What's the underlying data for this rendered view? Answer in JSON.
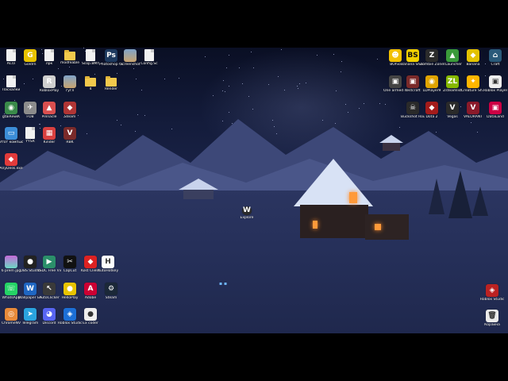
{
  "desktop": {
    "left_icons": [
      {
        "label": "AC\\n",
        "glyph": "file"
      },
      {
        "label": "Goldrn",
        "glyph": "G",
        "color": "#e7c200"
      },
      {
        "label": "лрк",
        "glyph": "file"
      },
      {
        "label": "modfeable",
        "glyph": "folder"
      },
      {
        "label": "Scop.BMY",
        "glyph": "file"
      },
      {
        "label": "Photoshop CC",
        "glyph": "Ps",
        "color": "#1e3a5f"
      },
      {
        "label": "Screenshot",
        "glyph": "img"
      },
      {
        "label": "Config.Sc",
        "glyph": "file"
      },
      {
        "label": "Пасхалки",
        "glyph": "file"
      },
      {
        "label": "RobloxPlay",
        "glyph": "R",
        "color": "#cfcfcf"
      },
      {
        "label": "гугл",
        "glyph": "img"
      },
      {
        "label": "4",
        "glyph": "folder"
      },
      {
        "label": "Render",
        "glyph": "folder"
      },
      {
        "label": "gtaiRewiK",
        "glyph": "◉",
        "color": "#3a8a4a"
      },
      {
        "label": "FOB",
        "glyph": "✈",
        "color": "#8c8c8c"
      },
      {
        "label": "Pinnacle",
        "glyph": "▲",
        "color": "#d94f4f"
      },
      {
        "label": "Steam",
        "glyph": "◆",
        "color": "#b03535"
      },
      {
        "label": "Этот компьютер",
        "glyph": "▭",
        "color": "#3c8dd8"
      },
      {
        "label": "YYSR",
        "glyph": "file"
      },
      {
        "label": "Kinder",
        "glyph": "▦",
        "color": "#d94040"
      },
      {
        "label": "RBK",
        "glyph": "V",
        "color": "#7a2a2a"
      },
      {
        "label": "AnyDesk.exe",
        "glyph": "◆",
        "color": "#e23b3b"
      },
      {
        "label": "6 prem jpg",
        "glyph": "img2"
      },
      {
        "label": "OBS Studio",
        "glyph": "●",
        "color": "#222"
      },
      {
        "label": "YSDC Free Video Editor",
        "glyph": "▶",
        "color": "#2b8f6a"
      },
      {
        "label": "CapCut",
        "glyph": "✂",
        "color": "#111"
      },
      {
        "label": "Kost Client",
        "glyph": "◆",
        "color": "#d22"
      },
      {
        "label": "AutoHotkey",
        "glyph": "H",
        "color": "#fff",
        "text": "#333"
      },
      {
        "label": "WhatsApp",
        "glyph": "☏",
        "color": "#25d366"
      },
      {
        "label": "Wallpaper Engine",
        "glyph": "W",
        "color": "#1f66c2"
      },
      {
        "label": "AutoClicker",
        "glyph": "↖",
        "color": "#3a3a3a"
      },
      {
        "label": "HelloPlay",
        "glyph": "●",
        "color": "#e8c400"
      },
      {
        "label": "Adobe",
        "glyph": "A",
        "color": "#c03"
      },
      {
        "label": "Steam",
        "glyph": "⚙",
        "color": "#1b2838"
      },
      {
        "label": "ChromeNV",
        "glyph": "◎",
        "color": "#e88a3a"
      },
      {
        "label": "Telegram",
        "glyph": "➤",
        "color": "#2aa3df"
      },
      {
        "label": "Discord",
        "glyph": "◕",
        "color": "#5865f2"
      },
      {
        "label": "Roblox Studio",
        "glyph": "◈",
        "color": "#1c6fd6"
      },
      {
        "label": "Ex coder",
        "glyph": "●",
        "color": "#eee",
        "text": "#333"
      }
    ],
    "right_icons": [
      {
        "label": "BOhio",
        "glyph": "☻",
        "color": "#f2c100"
      },
      {
        "label": "Banana Shooter",
        "glyph": "BS",
        "color": "#f0d000",
        "text": "#111"
      },
      {
        "label": "Zombie Zone Zero",
        "glyph": "Z",
        "color": "#2b2b2b"
      },
      {
        "label": "TLauncher",
        "glyph": "▲",
        "color": "#3a9a3a"
      },
      {
        "label": "Banana",
        "glyph": "◆",
        "color": "#e3c200"
      },
      {
        "label": "Craft",
        "glyph": "⌂",
        "color": "#2a5a7a"
      },
      {
        "label": "One armed robber",
        "glyph": "▣",
        "color": "#444"
      },
      {
        "label": "Testcraft",
        "glyph": "▣",
        "color": "#7a2a2a"
      },
      {
        "label": "LDPlayer9",
        "glyph": "◉",
        "color": "#e0a400"
      },
      {
        "label": "Zsteamlist",
        "glyph": "ZL",
        "color": "#86b800"
      },
      {
        "label": "Creature Sh...",
        "glyph": "✦",
        "color": "#ffb600"
      },
      {
        "label": "Roblox Player",
        "glyph": "▣",
        "color": "#eee",
        "text": "#333"
      },
      {
        "label": "Buckshot Roulette",
        "glyph": "☠",
        "color": "#2a2a2a"
      },
      {
        "label": "Dota 2",
        "glyph": "◆",
        "color": "#a31b1b"
      },
      {
        "label": "Vegas",
        "glyph": "V",
        "color": "#2a2a2a"
      },
      {
        "label": "VALORANT",
        "glyph": "V",
        "color": "#8a1a2a"
      },
      {
        "label": "DataLand",
        "glyph": "▣",
        "color": "#c04"
      },
      {
        "label": "Roblox Studio",
        "glyph": "◈",
        "color": "#b22"
      },
      {
        "label": "Корзина",
        "glyph": "🗑",
        "color": "#eaeaea",
        "text": "#333"
      }
    ],
    "center_item": {
      "label": "Explore",
      "glyph": "W"
    }
  }
}
